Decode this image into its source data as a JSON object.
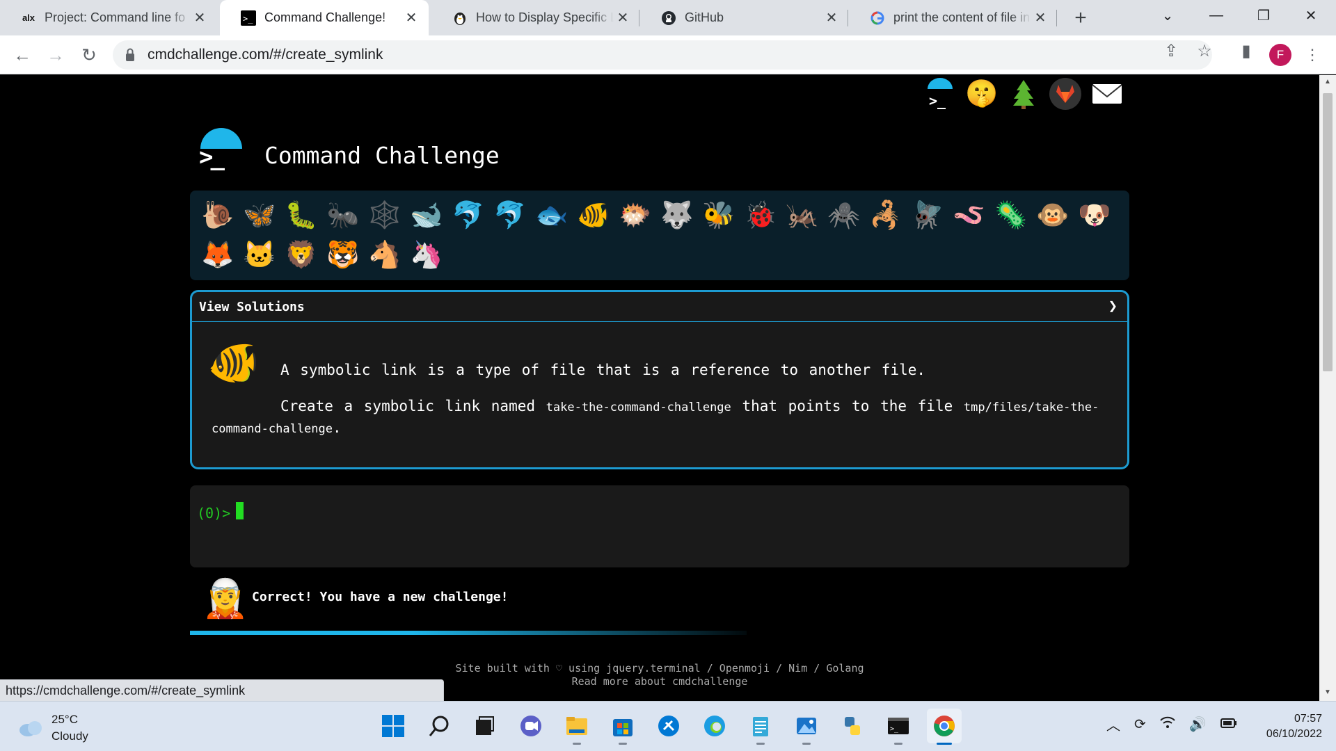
{
  "browser": {
    "tabs": [
      {
        "title": "Project: Command line fo",
        "favicon": "alx-logo"
      },
      {
        "title": "Command Challenge!",
        "favicon": "terminal-icon",
        "active": true
      },
      {
        "title": "How to Display Specific Li",
        "favicon": "linux-penguin-icon"
      },
      {
        "title": "GitHub",
        "favicon": "github-icon"
      },
      {
        "title": "print the content of file in",
        "favicon": "google-icon"
      }
    ],
    "url": "cmdchallenge.com/#/create_symlink",
    "profile_initial": "F",
    "status_url": "https://cmdchallenge.com/#/create_symlink"
  },
  "page": {
    "site_title": "Command Challenge",
    "logo_symbol": ">_",
    "top_icons": [
      "terminal-logo-icon",
      "shushing-face-icon",
      "tree-icon",
      "gitlab-icon",
      "mail-icon"
    ],
    "animals": [
      "🐌",
      "🦋",
      "🐛",
      "🐜",
      "🕸️",
      "🐋",
      "🐬",
      "🐬",
      "🐟",
      "🐠",
      "🐡",
      "🐺",
      "🐝",
      "🐞",
      "🦗",
      "🕷️",
      "🦂",
      "🪰",
      "🪱",
      "🦠",
      "🐵",
      "🐶",
      "🦊",
      "🐱",
      "🦁",
      "🐯",
      "🐴",
      "🦄"
    ],
    "solutions_label": "View Solutions",
    "challenge_icon": "🐠",
    "desc_line1": "A symbolic link is a type of file that is a reference to another file.",
    "desc_create": "Create a symbolic link named",
    "desc_link_name": "take-the-command-challenge",
    "desc_points": "that points to the file",
    "desc_target": "tmp/files/take-the-command-challenge",
    "desc_end": ".",
    "prompt": "(0)>",
    "result_icon": "🧝",
    "result_text": "Correct! You have a new challenge!",
    "progress_fraction": 0.4,
    "footer_line1": "Site built with ♡ using jquery.terminal / Openmoji / Nim / Golang",
    "footer_line2": "Read more about cmdchallenge"
  },
  "taskbar": {
    "temperature": "25°C",
    "condition": "Cloudy",
    "time": "07:57",
    "date": "06/10/2022"
  },
  "colors": {
    "accent": "#1d9bd1",
    "prompt_green": "#22c922",
    "panel_bg": "#0a1f2a"
  }
}
